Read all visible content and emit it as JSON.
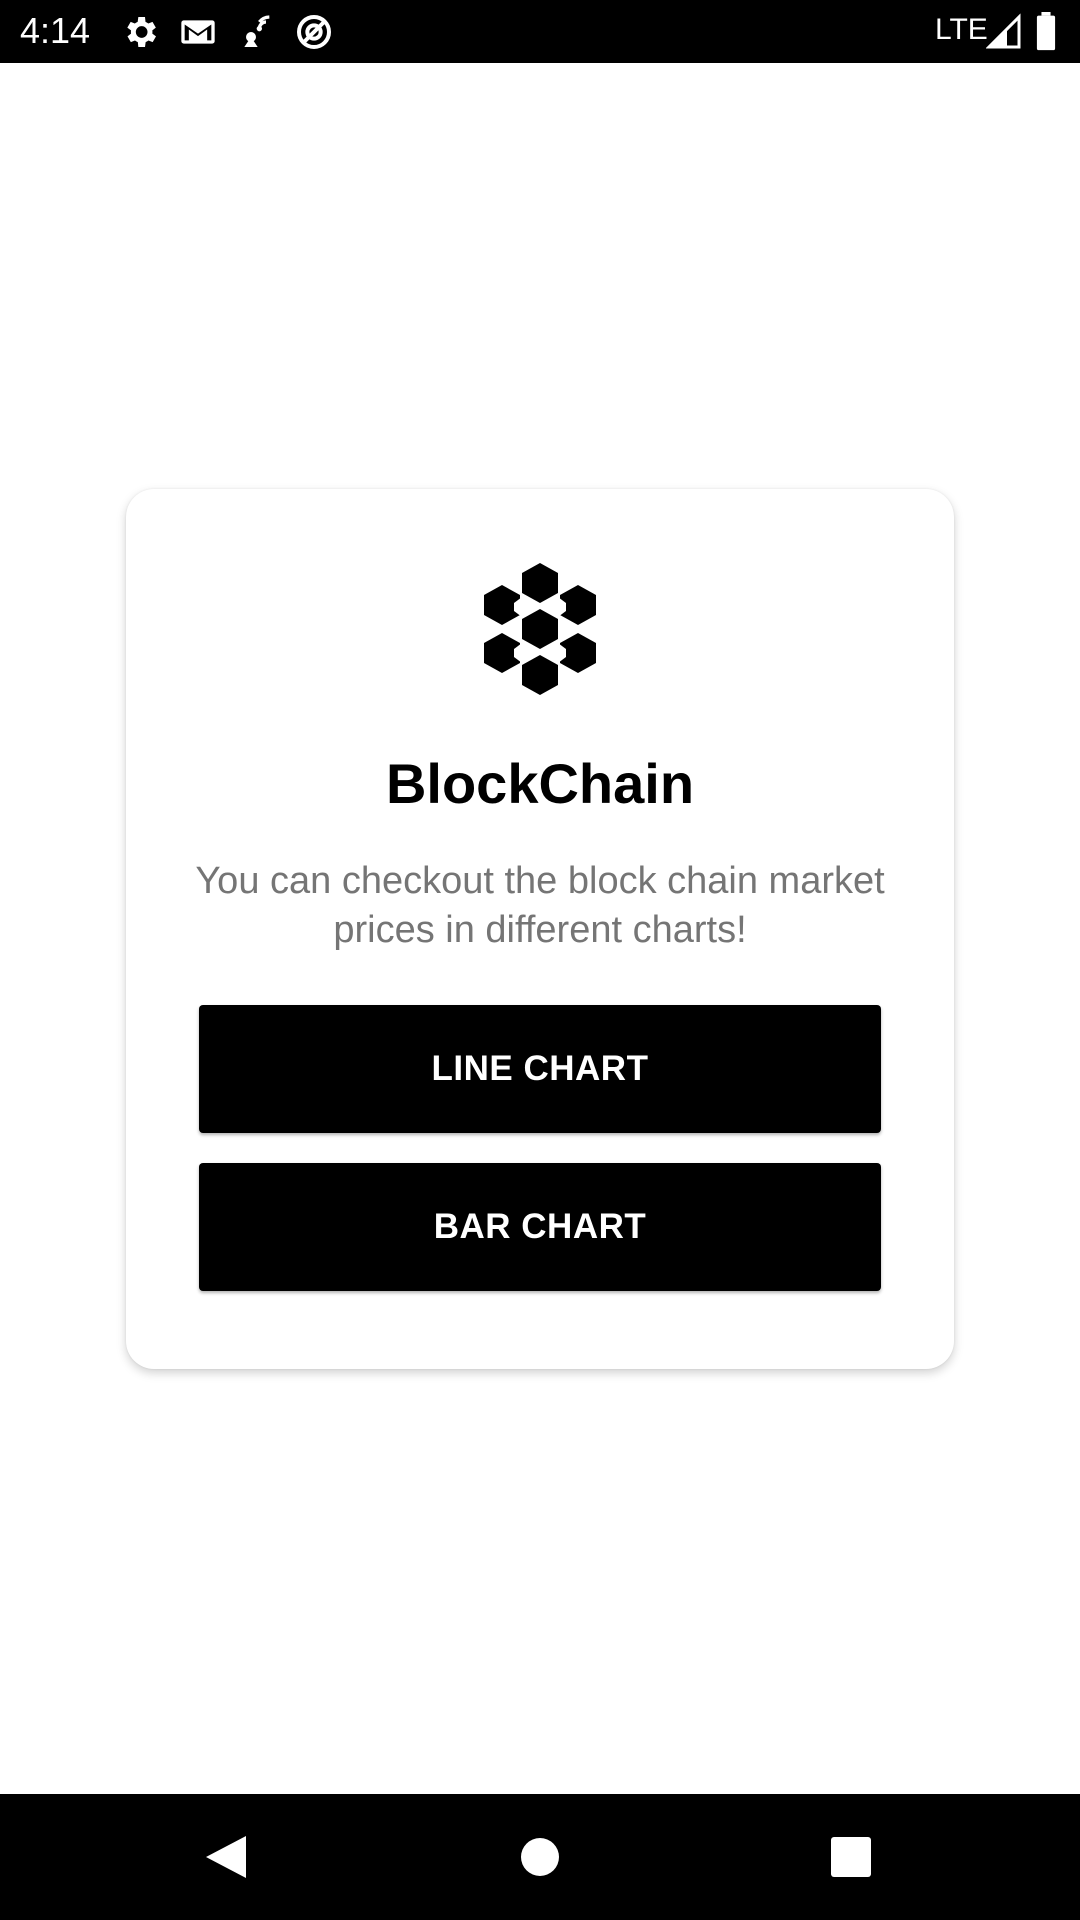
{
  "status_bar": {
    "time": "4:14",
    "network": "LTE",
    "icons": [
      "settings-icon",
      "gmail-icon",
      "signal-tower-icon",
      "do-not-disturb-icon",
      "cell-signal-icon",
      "battery-icon"
    ]
  },
  "card": {
    "logo_icon": "hexagon-cluster-icon",
    "title": "BlockChain",
    "description": "You can checkout the block chain market prices in different charts!",
    "buttons": {
      "line_chart": "LINE CHART",
      "bar_chart": "BAR CHART"
    }
  },
  "nav_bar": {
    "icons": [
      "back-icon",
      "home-icon",
      "recents-icon"
    ]
  },
  "colors": {
    "background": "#ffffff",
    "primary": "#000000",
    "description_text": "#757575",
    "button_text": "#ffffff"
  }
}
